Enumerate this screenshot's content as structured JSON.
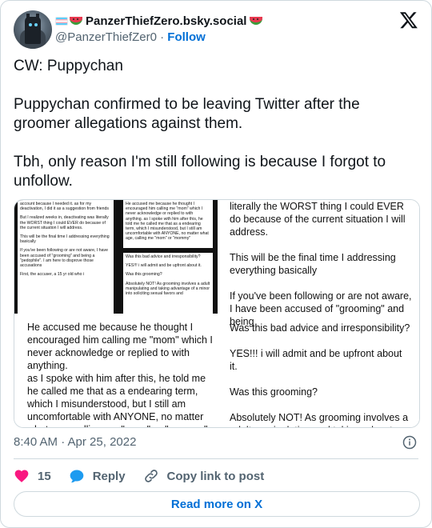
{
  "author": {
    "display_name": "PanzerThiefZero.bsky.social",
    "handle": "@PanzerThiefZer0",
    "separator": "·",
    "follow_label": "Follow"
  },
  "tweet": {
    "paragraphs": [
      "CW: Puppychan",
      "Puppychan confirmed to be leaving Twitter after the groomer allegations against them.",
      "Tbh, only reason I'm still following is because I forgot to unfollow."
    ]
  },
  "media": {
    "screenshot_a": [
      "account because I needed it. as for my deactivation, I did it as a suggestion from friends",
      "But I realized weeks in, deactivating was literally the WORST thing I could EVER do because of the current situation I will address.",
      "This will be the final time I addressing everything basically",
      "If you've been following or are not aware, I have been accused of \"grooming\" and being a \"pedophile\". I am here to disprove those accusations",
      "First, the accuser, a 15 yr old who i"
    ],
    "screenshot_b": "He accused me because he thought I encouraged him calling me \"mom\" which I never acknowledge or replied to with anything. as I spoke with him after this, he told me he called me that as a endearing term, which I misunderstood, but I still am uncomfortable with ANYONE, no matter what age, calling me \"mom\" or \"mommy\"",
    "screenshot_c": [
      "Was this bad advice and irresponsibility?",
      "YES!!! i will admit and be upfront about it.",
      "Was this grooming?",
      "Absolutely NOT! As grooming involves a adult manipulating and taking advantage of a minor into soliciting sexual favors and"
    ],
    "q2_text": " He accused me because he thought I encouraged him calling me \"mom\" which I never acknowledge or replied to with anything.\nas I spoke with him after this, he told me he called me that as a endearing term, which I misunderstood, but I still am uncomfortable with ANYONE, no matter what age, calling me \"mom\" or \"mommy\"",
    "q3_top": [
      "literally the WORST thing I could EVER do because of the current situation I will address.",
      "This will be the final time I addressing everything basically",
      "If you've been following or are not aware, I have been accused of \"grooming\" and being"
    ],
    "q3_bottom": [
      "Was this bad advice and irresponsibility?",
      "YES!!! i will admit and be upfront about it.",
      "Was this grooming?",
      "Absolutely NOT! As grooming involves a adult manipulating and taking advantage of a minor into soliciting sexual favors and"
    ]
  },
  "meta": {
    "timestamp": "8:40 AM · Apr 25, 2022"
  },
  "actions": {
    "like_count": "15",
    "reply_label": "Reply",
    "copy_label": "Copy link to post"
  },
  "footer": {
    "read_more_label": "Read more on X"
  },
  "colors": {
    "accent": "#006fd6",
    "like": "#f91880",
    "reply": "#1d9bf0",
    "border": "#cfd9de",
    "muted": "#536471"
  },
  "icons": [
    "x-logo-icon",
    "info-icon",
    "heart-icon",
    "reply-bubble-icon",
    "link-icon"
  ]
}
